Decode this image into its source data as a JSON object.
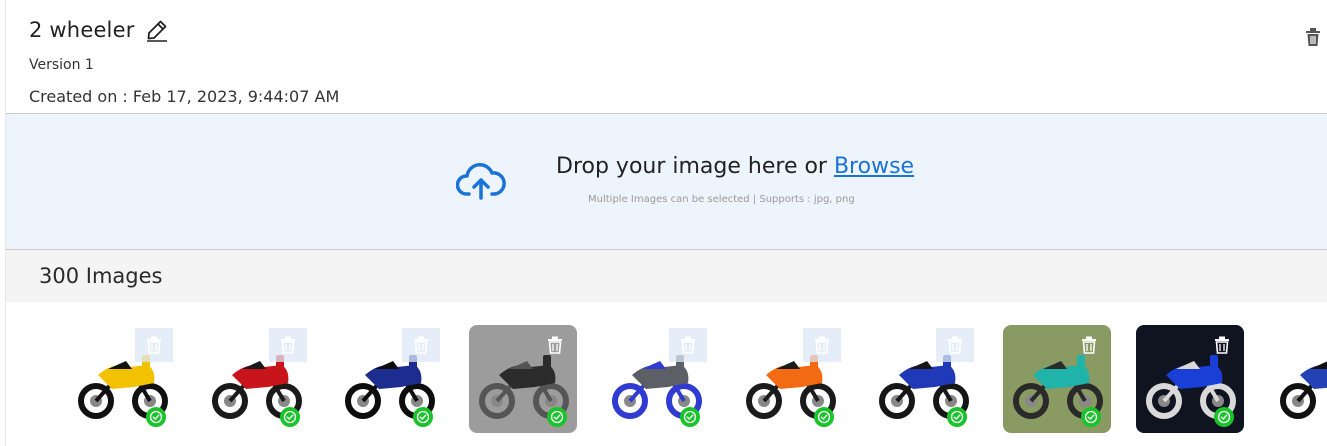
{
  "dataset": {
    "name": "2 wheeler",
    "version_label": "Version 1",
    "created_on": "Created on : Feb 17, 2023, 9:44:07 AM"
  },
  "upload": {
    "prompt": "Drop your image here or ",
    "browse_label": "Browse",
    "hint": "Multiple Images can be selected | Supports : jpg, png"
  },
  "gallery": {
    "count_label": "300 Images",
    "images": [
      {
        "bg": "#ffffff",
        "body_color": "#f2c200",
        "accent": "#111111",
        "status": "check-icon"
      },
      {
        "bg": "#ffffff",
        "body_color": "#c8151b",
        "accent": "#1a1a1a",
        "status": "check-icon"
      },
      {
        "bg": "#ffffff",
        "body_color": "#1d2d8f",
        "accent": "#0d0d0d",
        "status": "check-icon"
      },
      {
        "bg": "#9c9c9c",
        "body_color": "#2b2b2b",
        "accent": "#555555",
        "status": "check-icon"
      },
      {
        "bg": "#ffffff",
        "body_color": "#5c5f66",
        "accent": "#2f3bd1",
        "status": "check-icon"
      },
      {
        "bg": "#ffffff",
        "body_color": "#f26a12",
        "accent": "#1b1b1b",
        "status": "check-icon"
      },
      {
        "bg": "#ffffff",
        "body_color": "#2039b8",
        "accent": "#161616",
        "status": "check-icon"
      },
      {
        "bg": "#8a9a63",
        "body_color": "#1fb3a9",
        "accent": "#2a2a2a",
        "status": "check-icon"
      },
      {
        "bg": "#0f1420",
        "body_color": "#1a3fd6",
        "accent": "#d9d9d9",
        "status": "check-icon"
      },
      {
        "bg": "#ffffff",
        "body_color": "#2442b5",
        "accent": "#111111",
        "status": "check-icon"
      }
    ]
  },
  "colors": {
    "accent": "#1a73d9",
    "dropzone_bg": "#edf4fb",
    "success": "#19c42a"
  }
}
